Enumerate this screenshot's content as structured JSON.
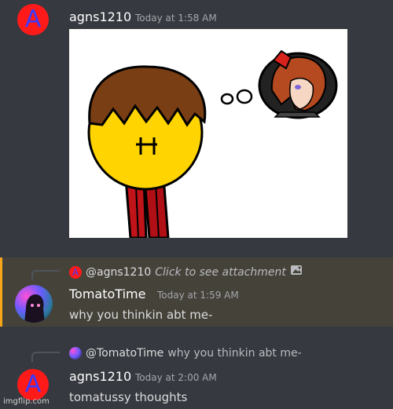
{
  "messages": [
    {
      "avatar_letter": "A",
      "username": "agns1210",
      "timestamp": "Today at 1:58 AM",
      "attachment_icon": "image-attachment-icon"
    },
    {
      "reply": {
        "avatar_letter": "A",
        "username": "@agns1210",
        "preview": "Click to see attachment",
        "attachment_icon": "image-icon"
      },
      "username": "TomatoTime",
      "timestamp": "Today at 1:59 AM",
      "content": "why you thinkin abt me-"
    },
    {
      "reply": {
        "username": "@TomatoTime",
        "preview": "why you thinkin abt me-"
      },
      "avatar_letter": "A",
      "username": "agns1210",
      "timestamp": "Today at 2:00 AM",
      "content": "tomatussy thoughts"
    }
  ],
  "watermark": "imgflip.com",
  "colors": {
    "background": "#36393f",
    "highlight": "#45423a",
    "highlight_bar": "#faa61a",
    "avatar_red": "#ff1a1a",
    "avatar_letter": "#3a3aff"
  }
}
